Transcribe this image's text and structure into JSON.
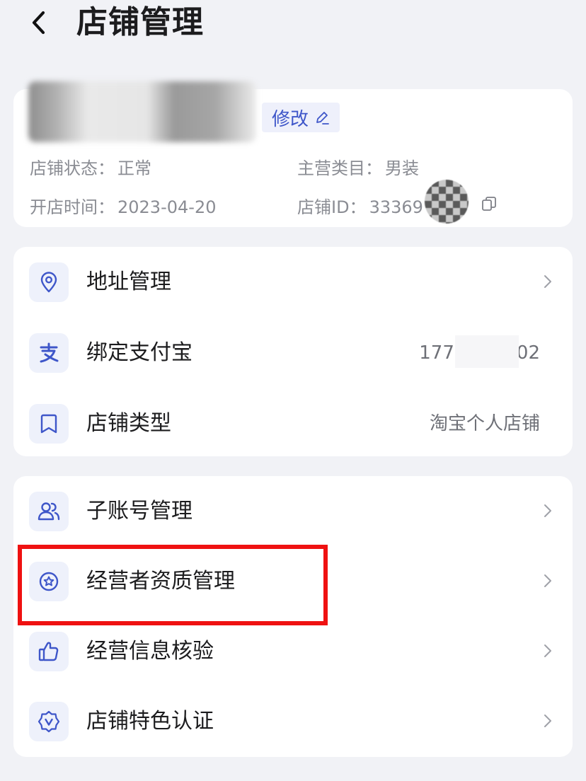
{
  "header": {
    "title": "店铺管理"
  },
  "store_info": {
    "edit_label": "修改",
    "status_label": "店铺状态：",
    "status_value": "正常",
    "category_label": "主营类目：",
    "category_value": "男装",
    "open_time_label": "开店时间：",
    "open_time_value": "2023-04-20",
    "store_id_label": "店铺ID：",
    "store_id_value": "33369"
  },
  "basic_items": [
    {
      "label": "地址管理",
      "value": "",
      "icon": "location-pin-icon"
    },
    {
      "label": "绑定支付宝",
      "value_prefix": "177",
      "value_suffix": "02",
      "icon": "alipay-icon"
    },
    {
      "label": "店铺类型",
      "value": "淘宝个人店铺",
      "icon": "bookmark-icon"
    }
  ],
  "manage_items": [
    {
      "label": "子账号管理",
      "icon": "sub-account-icon"
    },
    {
      "label": "经营者资质管理",
      "icon": "star-badge-icon"
    },
    {
      "label": "经营信息核验",
      "icon": "thumbs-up-icon"
    },
    {
      "label": "店铺特色认证",
      "icon": "verified-shield-icon"
    }
  ],
  "colors": {
    "accent": "#3e56c9",
    "highlight": "#ef1111",
    "background": "#f1f2f6"
  }
}
